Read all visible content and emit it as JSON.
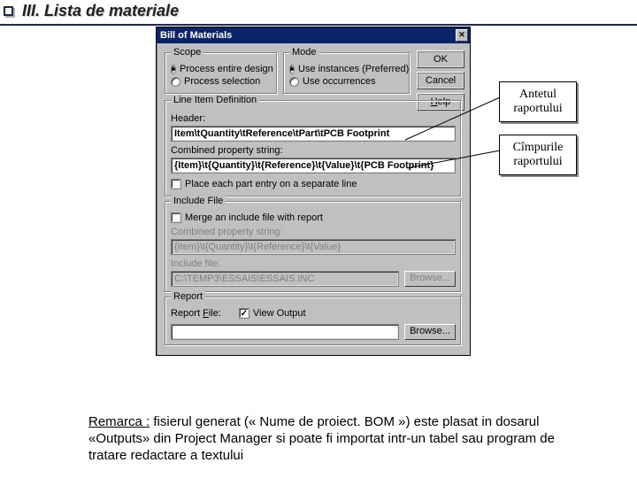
{
  "slide": {
    "title": "III. Lista de materiale"
  },
  "dialog": {
    "title": "Bill of Materials",
    "close": "✕",
    "buttons": {
      "ok": "OK",
      "cancel": "Cancel",
      "help_pre": "",
      "help_u": "H",
      "help_post": "elp"
    },
    "scope": {
      "legend": "Scope",
      "opt1": "Process entire design",
      "opt2": "Process selection"
    },
    "mode": {
      "legend": "Mode",
      "opt1": "Use instances (Preferred)",
      "opt2": "Use occurrences"
    },
    "line_item": {
      "legend": "Line Item Definition",
      "header_label": "Header:",
      "header_value": "Item\\tQuantity\\tReference\\tPart\\tPCB Footprint",
      "cps_label": "Combined property string:",
      "cps_value": "{Item}\\t{Quantity}\\t{Reference}\\t{Value}\\t{PCB Footprint}",
      "separate_line": "Place each part entry on a separate line"
    },
    "include": {
      "legend": "Include File",
      "merge": "Merge an include file with report",
      "cps_label": "Combined property string:",
      "cps_value": "{Item}\\t{Quantity}\\t{Reference}\\t{Value}",
      "inc_label": "Include file:",
      "inc_value": "C:\\TEMP3\\ESSAIS\\ESSAIS.INC",
      "browse": "Browse..."
    },
    "report": {
      "legend": "Report",
      "file_label_pre": "Report ",
      "file_u": "F",
      "file_label_post": "ile:",
      "view_output": "View Output",
      "browse": "Browse..."
    }
  },
  "callouts": {
    "c1": "Antetul raportului",
    "c2": "Cîmpurile raportului"
  },
  "footnote": {
    "lead": "Remarca :",
    "rest": " fisierul generat (« Nume de proiect. BOM ») este plasat in dosarul «Outputs» din Project Manager si poate fi importat intr-un tabel sau program de tratare redactare a textului"
  }
}
